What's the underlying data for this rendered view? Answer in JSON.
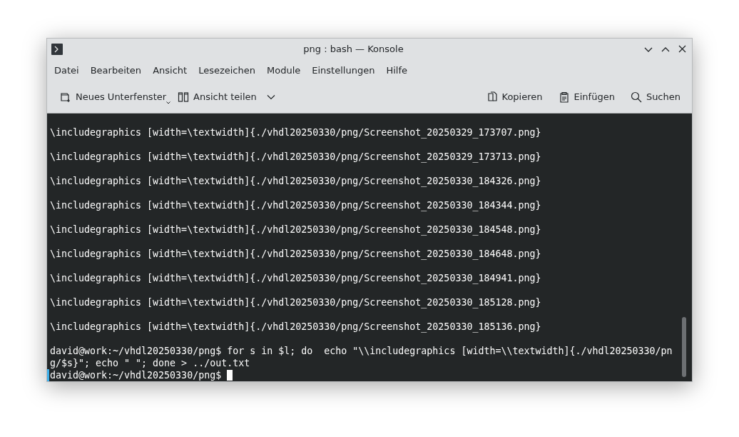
{
  "window": {
    "title": "png : bash — Konsole"
  },
  "menu": [
    "Datei",
    "Bearbeiten",
    "Ansicht",
    "Lesezeichen",
    "Module",
    "Einstellungen",
    "Hilfe"
  ],
  "toolbar": {
    "left": [
      {
        "kind": "new-tab",
        "label": "Neues Unterfenster"
      },
      {
        "kind": "split",
        "label": "Ansicht teilen"
      }
    ],
    "right": [
      {
        "kind": "copy",
        "label": "Kopieren"
      },
      {
        "kind": "paste",
        "label": "Einfügen"
      },
      {
        "kind": "search",
        "label": "Suchen"
      }
    ]
  },
  "terminal": {
    "lines": [
      {
        "kind": "output",
        "text": "\\includegraphics [width=\\textwidth]{./vhdl20250330/png/Screenshot_20250329_173707.png}"
      },
      {
        "kind": "output",
        "text": "\\includegraphics [width=\\textwidth]{./vhdl20250330/png/Screenshot_20250329_173713.png}"
      },
      {
        "kind": "output",
        "text": "\\includegraphics [width=\\textwidth]{./vhdl20250330/png/Screenshot_20250330_184326.png}"
      },
      {
        "kind": "output",
        "text": "\\includegraphics [width=\\textwidth]{./vhdl20250330/png/Screenshot_20250330_184344.png}"
      },
      {
        "kind": "output",
        "text": "\\includegraphics [width=\\textwidth]{./vhdl20250330/png/Screenshot_20250330_184548.png}"
      },
      {
        "kind": "output",
        "text": "\\includegraphics [width=\\textwidth]{./vhdl20250330/png/Screenshot_20250330_184648.png}"
      },
      {
        "kind": "output",
        "text": "\\includegraphics [width=\\textwidth]{./vhdl20250330/png/Screenshot_20250330_184941.png}"
      },
      {
        "kind": "output",
        "text": "\\includegraphics [width=\\textwidth]{./vhdl20250330/png/Screenshot_20250330_185128.png}"
      },
      {
        "kind": "output",
        "text": "\\includegraphics [width=\\textwidth]{./vhdl20250330/png/Screenshot_20250330_185136.png}"
      },
      {
        "kind": "command",
        "text": "david@work:~/vhdl20250330/png$ for s in $l; do  echo \"\\\\includegraphics [width=\\\\textwidth]{./vhdl20250330/pn"
      },
      {
        "kind": "command",
        "text": "g/$s}\"; echo \" \"; done > ../out.txt"
      },
      {
        "kind": "prompt",
        "text": "david@work:~/vhdl20250330/png$"
      }
    ]
  }
}
